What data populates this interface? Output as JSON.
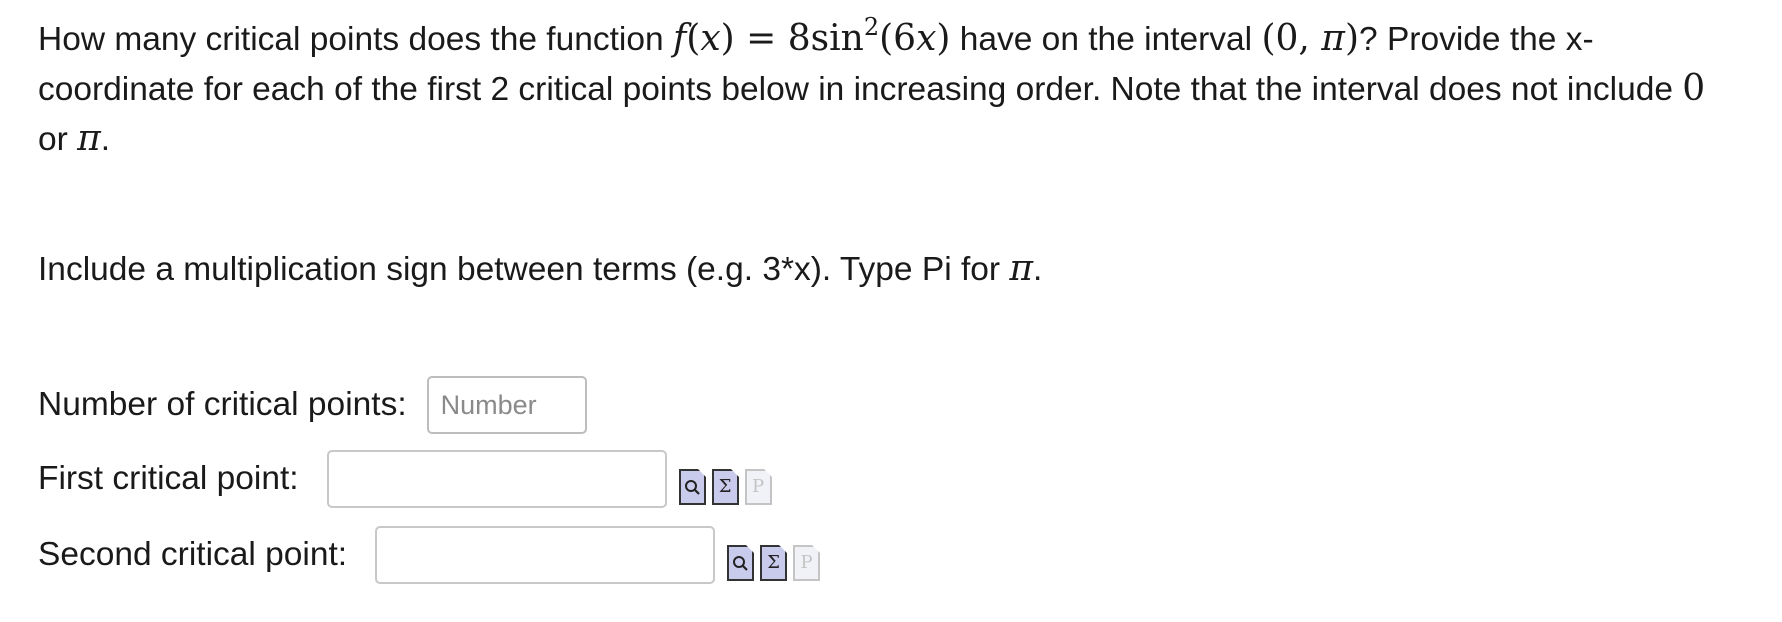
{
  "problem": {
    "text_1": "How many critical points does the function",
    "f": "f",
    "x": "x",
    "eq_rhs_coef": "8sin",
    "exp": "2",
    "arg_coef": "6",
    "text_2": "have on the interval",
    "interval_open": "(0, ",
    "pi": "π",
    "interval_close": ")",
    "text_3": "? Provide the x-coordinate for each of the first 2 critical points below in increasing order. Note that the interval does not include",
    "zero": "0",
    "or": "or",
    "pi_2": "π",
    "period": "."
  },
  "instruction": {
    "text": "Include a multiplication sign between terms (e.g. 3*x). Type Pi for",
    "pi": "π",
    "period": "."
  },
  "form": {
    "count_label": "Number of critical points:",
    "count_placeholder": "Number",
    "count_value": "",
    "first_label": "First critical point:",
    "first_value": "",
    "second_label": "Second critical point:",
    "second_value": ""
  },
  "tools": {
    "preview_icon": "preview-icon",
    "equation_glyph": "Σ",
    "equation_icon": "equation-editor-icon",
    "p_glyph": "P",
    "p_icon": "p-icon"
  }
}
